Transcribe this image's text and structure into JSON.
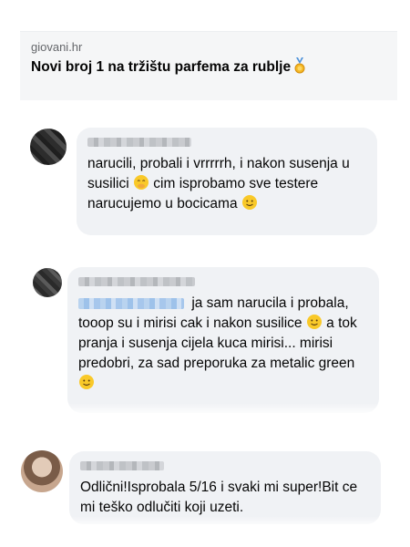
{
  "link_preview": {
    "domain": "giovani.hr",
    "title": "Novi broj 1 na tržištu parfema za rublje",
    "medal_icon": "gold-medal-icon"
  },
  "comments": [
    {
      "text_1": "narucili, probali i vrrrrrh, i nakon susenja u susilici",
      "text_2": "cim isprobamo sve testere narucujemo u bocicama",
      "emojis": [
        "face-with-hand-over-mouth-icon",
        "smiling-face-icon"
      ]
    },
    {
      "text_1": "ja sam narucila i probala, tooop su i mirisi cak i nakon susilice",
      "text_2": "a tok pranja i susenja cijela kuca mirisi... mirisi predobri, za sad preporuka za metalic green",
      "emojis": [
        "smiling-face-icon",
        "smiling-face-icon"
      ]
    },
    {
      "text_1": "Odlični!Isprobala 5/16 i svaki mi super!Bit ce mi teško odlučiti koji uzeti."
    }
  ],
  "colors": {
    "bubble": "#f0f2f5",
    "text": "#050505",
    "muted": "#65676b",
    "emoji_yellow": "#f9c929"
  }
}
